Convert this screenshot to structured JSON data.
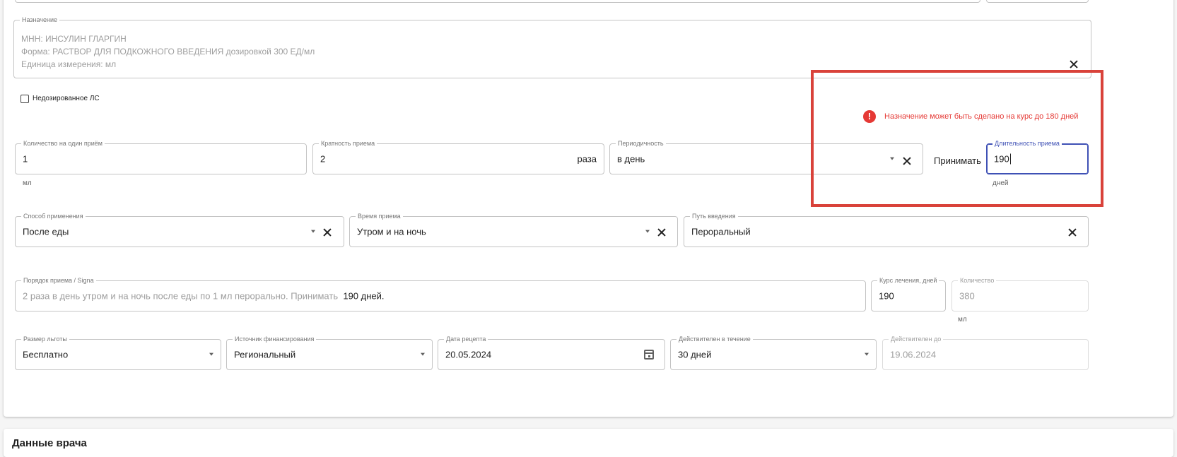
{
  "prescription": {
    "label": "Назначение",
    "line1": "МНН: ИНСУЛИН ГЛАРГИН",
    "line2": "Форма: РАСТВОР ДЛЯ ПОДКОЖНОГО ВВЕДЕНИЯ дозировкой 300 ЕД/мл",
    "line3": "Единица измерения: мл"
  },
  "underdosed_checkbox": {
    "label": "Недозированное ЛС",
    "checked": false
  },
  "alert": {
    "text": "Назначение может быть сделано на курс до 180 дней",
    "icon": "error-icon",
    "color": "#e53935"
  },
  "dose": {
    "qty_label": "Количество на один приём",
    "qty_value": "1",
    "qty_unit": "мл",
    "mult_label": "Кратность приема",
    "mult_value": "2",
    "mult_suffix": "раза",
    "period_label": "Периодичность",
    "period_value": "в день",
    "take_label": "Принимать",
    "duration_label": "Длительность приема",
    "duration_value": "190",
    "duration_unit": "дней"
  },
  "admin": {
    "method_label": "Способ применения",
    "method_value": "После еды",
    "time_label": "Время приема",
    "time_value": "Утром и на ночь",
    "route_label": "Путь введения",
    "route_value": "Пероральный"
  },
  "signa": {
    "label": "Порядок приема / Signa",
    "text": "2 раза в день утром и на ночь после еды по 1 мл перорально. Принимать",
    "days": "190 дней.",
    "course_label": "Курс лечения, дней",
    "course_value": "190",
    "count_label": "Количество",
    "count_value": "380",
    "count_unit": "мл"
  },
  "recipe": {
    "benefit_label": "Размер льготы",
    "benefit_value": "Бесплатно",
    "source_label": "Источник финансирования",
    "source_value": "Региональный",
    "date_label": "Дата рецепта",
    "date_value": "20.05.2024",
    "valid_label": "Действителен в течение",
    "valid_value": "30 дней",
    "until_label": "Действителен до",
    "until_value": "19.06.2024"
  },
  "doctor_section": {
    "title": "Данные врача"
  },
  "colors": {
    "accent": "#3f51b5",
    "error": "#e53935",
    "highlight_box": "#d9423a"
  }
}
